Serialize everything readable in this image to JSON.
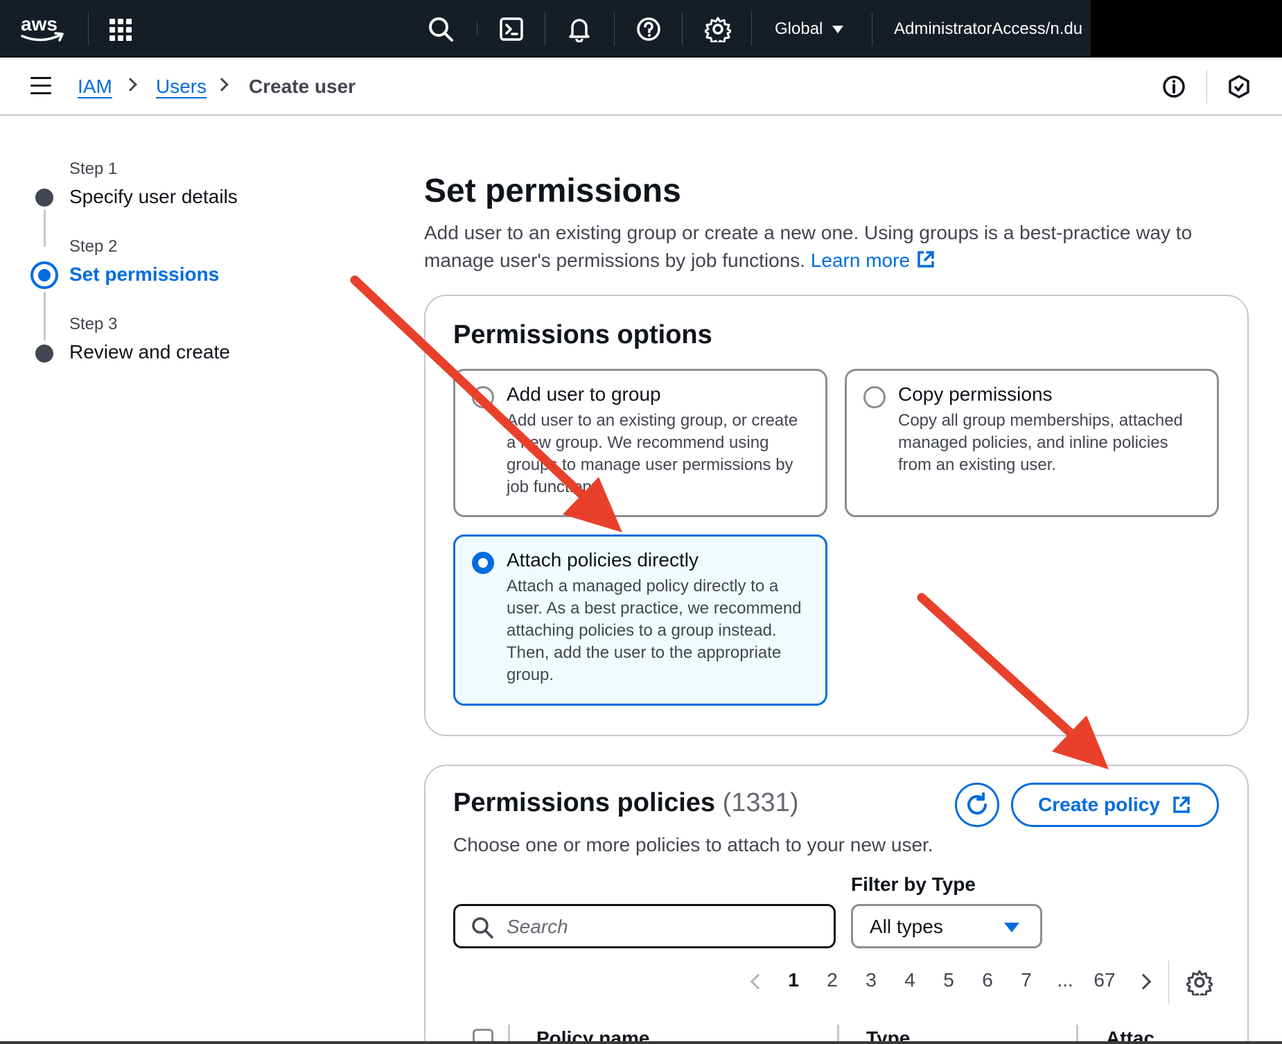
{
  "topnav": {
    "logo_text": "aws",
    "region": "Global",
    "account": "AdministratorAccess/n.du"
  },
  "breadcrumbs": [
    {
      "label": "IAM"
    },
    {
      "label": "Users"
    },
    {
      "label": "Create user"
    }
  ],
  "steps": [
    {
      "label": "Step 1",
      "title": "Specify user details",
      "state": "complete"
    },
    {
      "label": "Step 2",
      "title": "Set permissions",
      "state": "active"
    },
    {
      "label": "Step 3",
      "title": "Review and create",
      "state": "pending"
    }
  ],
  "header": {
    "title": "Set permissions",
    "description": "Add user to an existing group or create a new one. Using groups is a best-practice way to manage user's permissions by job functions.",
    "learn_more": "Learn more"
  },
  "permissions_options": {
    "title": "Permissions options",
    "options": [
      {
        "title": "Add user to group",
        "description": "Add user to an existing group, or create a new group. We recommend using groups to manage user permissions by job function.",
        "selected": false
      },
      {
        "title": "Copy permissions",
        "description": "Copy all group memberships, attached managed policies, and inline policies from an existing user.",
        "selected": false
      },
      {
        "title": "Attach policies directly",
        "description": "Attach a managed policy directly to a user. As a best practice, we recommend attaching policies to a group instead. Then, add the user to the appropriate group.",
        "selected": true
      }
    ]
  },
  "permissions_policies": {
    "title": "Permissions policies",
    "count": "(1331)",
    "create_policy": "Create policy",
    "description": "Choose one or more policies to attach to your new user.",
    "filter_label": "Filter by Type",
    "search_placeholder": "Search",
    "filter_value": "All types",
    "pagination": [
      "1",
      "2",
      "3",
      "4",
      "5",
      "6",
      "7",
      "...",
      "67"
    ],
    "current_page": "1",
    "columns": [
      "Policy name",
      "Type",
      "Attac"
    ]
  },
  "colors": {
    "accent": "#006ce0",
    "annotation_arrow": "#e8402a",
    "nav_bg": "#161d26"
  }
}
